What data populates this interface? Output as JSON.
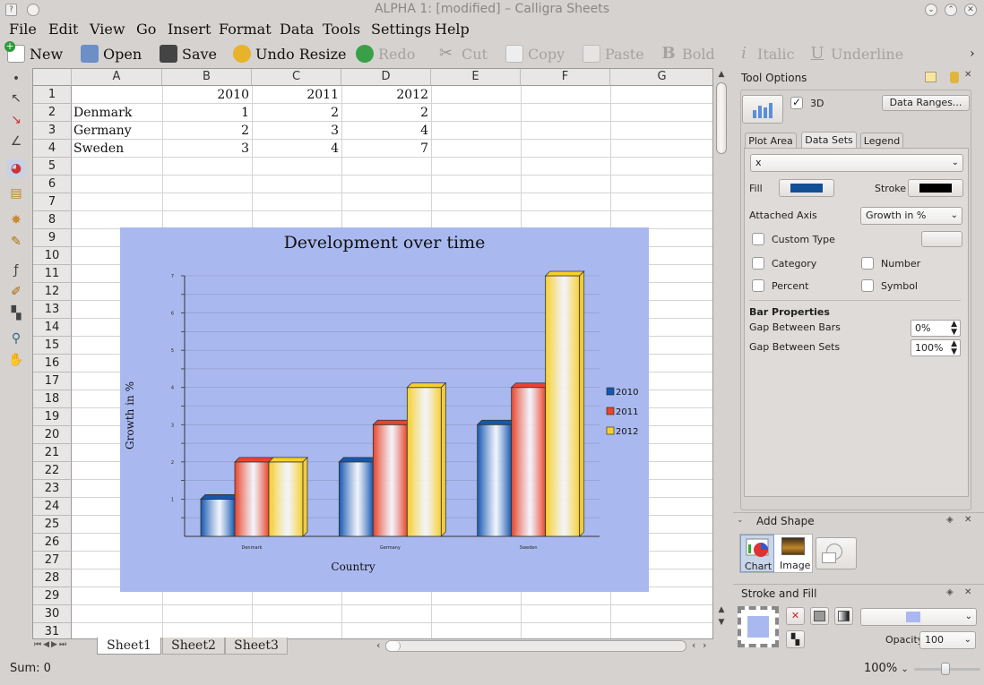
{
  "window": {
    "title": "ALPHA 1:  [modified] – Calligra Sheets"
  },
  "menu": [
    "File",
    "Edit",
    "View",
    "Go",
    "Insert",
    "Format",
    "Data",
    "Tools",
    "Settings",
    "Help"
  ],
  "toolbar": {
    "new": "New",
    "open": "Open",
    "save": "Save",
    "undo": "Undo Resize",
    "redo": "Redo",
    "cut": "Cut",
    "copy": "Copy",
    "paste": "Paste",
    "bold": "Bold",
    "italic": "Italic",
    "underline": "Underline",
    "more": "›"
  },
  "sheet": {
    "columns": [
      "A",
      "B",
      "C",
      "D",
      "E",
      "F",
      "G"
    ],
    "rows": [
      "1",
      "2",
      "3",
      "4",
      "5",
      "6",
      "7",
      "8",
      "9",
      "10",
      "11",
      "12",
      "13",
      "14",
      "15",
      "16",
      "17",
      "18",
      "19",
      "20",
      "21",
      "22",
      "23",
      "24",
      "25",
      "26",
      "27",
      "28",
      "29",
      "30",
      "31"
    ],
    "header_years": [
      "2010",
      "2011",
      "2012"
    ],
    "data_rows": [
      {
        "name": "Denmark",
        "values": [
          "1",
          "2",
          "2"
        ]
      },
      {
        "name": "Germany",
        "values": [
          "2",
          "3",
          "4"
        ]
      },
      {
        "name": "Sweden",
        "values": [
          "3",
          "4",
          "7"
        ]
      }
    ],
    "tabs": [
      "Sheet1",
      "Sheet2",
      "Sheet3"
    ]
  },
  "chart_data": {
    "type": "bar",
    "title": "Development over time",
    "xlabel": "Country",
    "ylabel": "Growth in %",
    "categories": [
      "Denmark",
      "Germany",
      "Sweden"
    ],
    "series": [
      {
        "name": "2010",
        "values": [
          1,
          2,
          3
        ],
        "color": "#1557b0"
      },
      {
        "name": "2011",
        "values": [
          2,
          3,
          4
        ],
        "color": "#e8452c"
      },
      {
        "name": "2012",
        "values": [
          2,
          4,
          7
        ],
        "color": "#f7cf2b"
      }
    ],
    "yticks": [
      "1",
      "2",
      "3",
      "4",
      "5",
      "6",
      "7"
    ],
    "ylim": [
      0,
      7
    ],
    "grid": true,
    "legend": "right",
    "background": "#a9b9ef"
  },
  "tool_options": {
    "title": "Tool Options",
    "three_d": "3D",
    "data_ranges": "Data Ranges...",
    "tabs": [
      "Plot Area",
      "Data Sets",
      "Legend"
    ],
    "dataset_select": "x",
    "fill_label": "Fill",
    "fill_color": "#124f94",
    "stroke_label": "Stroke",
    "stroke_color": "#000000",
    "attached_axis_label": "Attached Axis",
    "attached_axis_value": "Growth in %",
    "custom_type": "Custom Type",
    "category": "Category",
    "number": "Number",
    "percent": "Percent",
    "symbol": "Symbol",
    "bar_props": "Bar Properties",
    "gap_bars_label": "Gap Between Bars",
    "gap_bars_value": "0%",
    "gap_sets_label": "Gap Between Sets",
    "gap_sets_value": "100%"
  },
  "add_shape": {
    "title": "Add Shape",
    "chart": "Chart",
    "image": "Image"
  },
  "stroke_fill": {
    "title": "Stroke and Fill",
    "opacity_label": "Opacity:",
    "opacity_value": "100"
  },
  "status": {
    "sum": "Sum: 0",
    "zoom": "100%"
  }
}
